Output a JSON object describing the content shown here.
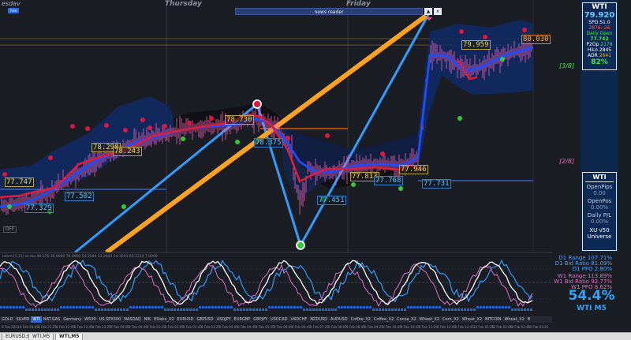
{
  "window": {
    "symbol_title": "esdav"
  },
  "badge": "Free",
  "days": [
    "Thursday",
    "Friday"
  ],
  "news_reader": {
    "label": "news reader",
    "ctl_up": "▲",
    "ctl_close": "x"
  },
  "price_labels": [
    {
      "text": "77.747",
      "style": "y"
    },
    {
      "text": "77.329",
      "style": "c"
    },
    {
      "text": "77.502",
      "style": "c"
    },
    {
      "text": "78.298",
      "style": "y"
    },
    {
      "text": "78.243",
      "style": "y"
    },
    {
      "text": "78.730",
      "style": "y"
    },
    {
      "text": "78.375",
      "style": "c"
    },
    {
      "text": "77.451",
      "style": "c"
    },
    {
      "text": "77.813",
      "style": "y"
    },
    {
      "text": "77.768",
      "style": "c"
    },
    {
      "text": "77.946",
      "style": "y"
    },
    {
      "text": "77.731",
      "style": "c"
    },
    {
      "text": "79.959",
      "style": "y"
    },
    {
      "text": "80.030",
      "style": "o"
    }
  ],
  "fib_labels": {
    "upper": "[3/8]",
    "lower": "[2/8]"
  },
  "off_button": "OFF",
  "wti_box": {
    "symbol": "WTI",
    "price": "79.920",
    "spread_line": "SPD:51.0",
    "change_line": "2876:-26",
    "daily_open_label": "Daily Open",
    "daily_open_value": "77.742",
    "p2op_label": "P2Op",
    "p2op_value": "2178",
    "hilo_label": "HiLo",
    "hilo_value": "2845",
    "adr_label": "ADR",
    "adr_value": "2641",
    "pct": "82%"
  },
  "wti_panel": {
    "header": "WTI",
    "open_pips_label": "OpenPips",
    "open_pips_value": "0.00",
    "open_pos_label": "OpenPos",
    "open_pos_value": "0.00%",
    "daily_pl_label": "Daily P/L",
    "daily_pl_value": "0.00%",
    "universe_line1": "XU v50",
    "universe_line2": "Universe"
  },
  "indicator": {
    "title": "Istomi(5,11) ss ma 46.176 36.0000 76.0000 54.2504 53.2643 54.3543 65.1234 7.0000",
    "stats": [
      {
        "text": "D1 Range 107.71%",
        "color": "#4ea2ff"
      },
      {
        "text": "D1 Bid Ratio 81.09%",
        "color": "#4ea2ff"
      },
      {
        "text": "D1 PFO 2.80%",
        "color": "#4ea2ff"
      },
      {
        "text": "W1 Range 113.89%",
        "color": "#e070c8"
      },
      {
        "text": "W1 Bid Ratio 92.77%",
        "color": "#e070c8"
      },
      {
        "text": "W1 PFO 8.62%",
        "color": "#e070c8"
      }
    ],
    "big_pct": "54.4%",
    "big_sub": "WTI M5"
  },
  "symbol_strip": [
    "GOLD",
    "SILVER",
    "WTI",
    "NAT.GAS",
    "Germany",
    "WS30",
    "US SPX500",
    "NASDAQ",
    "NIK",
    "ESlaks_X2",
    "EURUSD",
    "GBPUSD",
    "USDJPY",
    "EURGBP",
    "GBPJPY",
    "USDCAD",
    "USDCHF",
    "NZDUSD",
    "AUDUSD",
    "Coffee_X2",
    "Coffee_X2",
    "Cocoa_X2",
    "Wheat_X2",
    "Corn_X2",
    "Wheat_X2",
    "BITCOIN",
    "Wheat_X2",
    "BITCOIN"
  ],
  "selected_symbol_index": 2,
  "time_ticks": [
    "8 Feb 2023",
    "8 Feb 20:45",
    "8 Feb 21:25",
    "8 Feb 22:05",
    "8 Feb 22:45",
    "8 Feb 23:25",
    "9 Feb 00:05",
    "9 Feb 00:45",
    "9 Feb 01:25",
    "9 Feb 02:05",
    "9 Feb 02:45",
    "9 Feb 03:25",
    "9 Feb 04:05",
    "9 Feb 04:45",
    "9 Feb 05:25",
    "9 Feb 06:05",
    "9 Feb 06:45",
    "9 Feb 07:25",
    "9 Feb 08:05",
    "9 Feb 08:45",
    "9 Feb 09:25",
    "9 Feb 10:05",
    "9 Feb 10:45",
    "9 Feb 11:25",
    "9 Feb 12:05",
    "9 Feb 12:45",
    "10 Feb 01:25",
    "10 Feb 02:05",
    "10 Feb 02:45",
    "10 Feb 03:25"
  ],
  "tabs": [
    "EURUSD,H1",
    "WTI,M5",
    "WTI,M5"
  ],
  "active_tab_index": 2,
  "colors": {
    "background": "#1b1d24",
    "cloud": "#0f2a66",
    "ribbon_blue": "#1e4dff",
    "ribbon_red": "#e01c3a",
    "candles": "#f25fb0",
    "zigzag": "#2f9cff",
    "trendline": "#ffa31f"
  }
}
